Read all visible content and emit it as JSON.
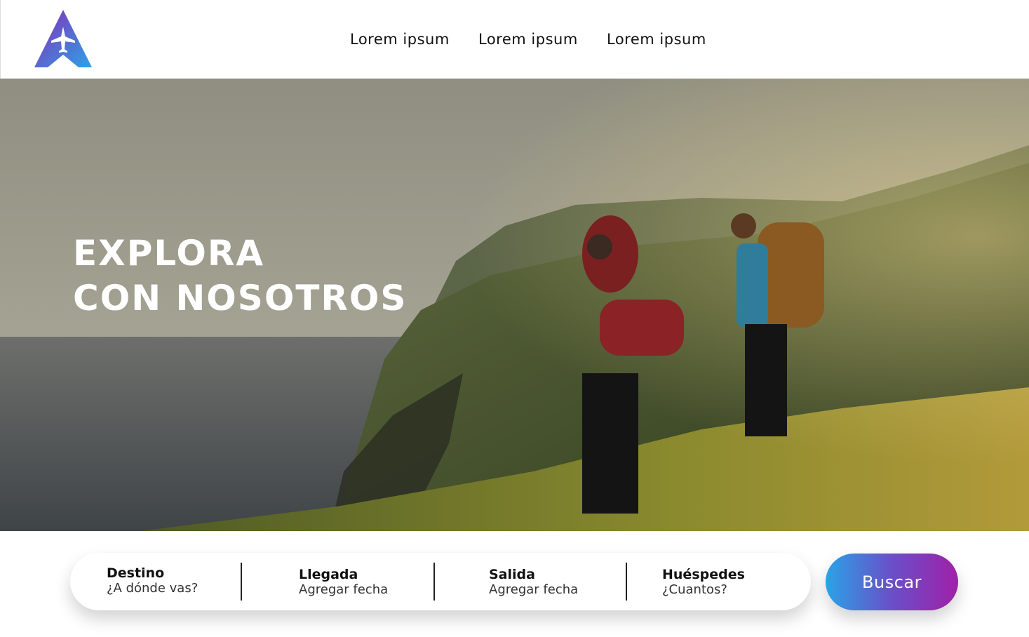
{
  "brand": {
    "logo_icon": "airplane-triangle-logo-icon",
    "accent_start": "#7b2fbe",
    "accent_end": "#2aa3e6"
  },
  "nav": {
    "items": [
      {
        "label": "Lorem ipsum"
      },
      {
        "label": "Lorem ipsum"
      },
      {
        "label": "Lorem ipsum"
      }
    ]
  },
  "hero": {
    "title_line1": "EXPLORA",
    "title_line2": "CON NOSOTROS",
    "image": "hikers-on-coastal-cliff-photo"
  },
  "search": {
    "fields": [
      {
        "label": "Destino",
        "placeholder": "¿A dónde vas?"
      },
      {
        "label": "Llegada",
        "placeholder": "Agregar fecha"
      },
      {
        "label": "Salida",
        "placeholder": "Agregar fecha"
      },
      {
        "label": "Huéspedes",
        "placeholder": "¿Cuantos?"
      }
    ],
    "button_label": "Buscar",
    "button_gradient": [
      "#2aa3e6",
      "#a020a8"
    ]
  }
}
